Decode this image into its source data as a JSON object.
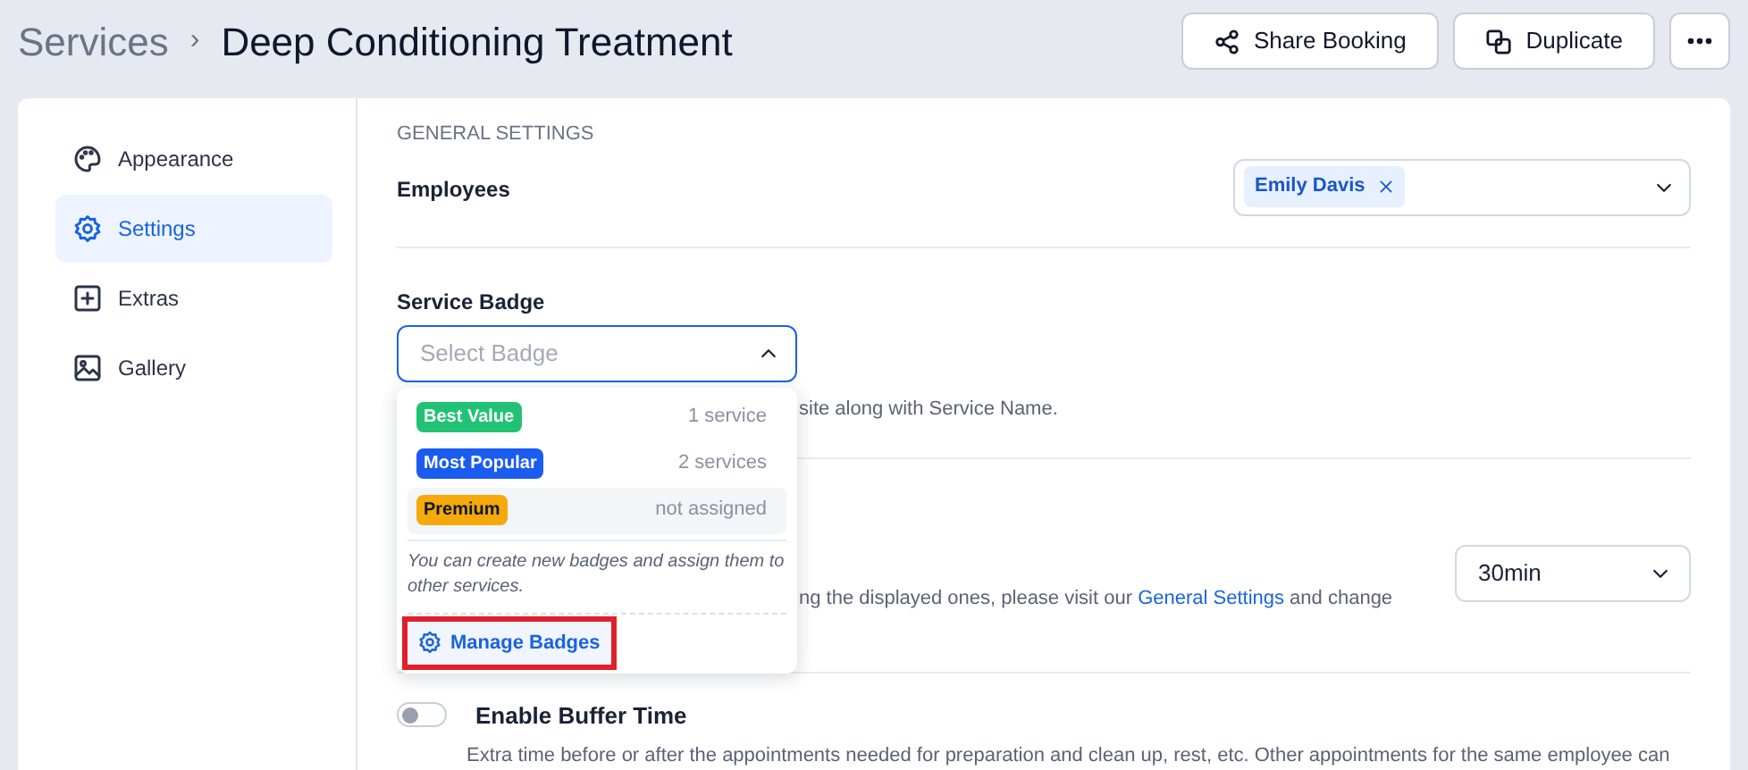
{
  "header": {
    "breadcrumb_parent": "Services",
    "separator": "›",
    "title": "Deep Conditioning Treatment",
    "buttons": [
      {
        "label": "Share Booking",
        "kind": "share"
      },
      {
        "label": "Duplicate",
        "kind": "duplicate"
      },
      {
        "kind": "more"
      }
    ]
  },
  "sidebar": {
    "items": [
      {
        "label": "Appearance",
        "kind": "palette",
        "selected": false
      },
      {
        "label": "Settings",
        "kind": "gear",
        "selected": true
      },
      {
        "label": "Extras",
        "kind": "plus",
        "selected": false
      },
      {
        "label": "Gallery",
        "kind": "image",
        "selected": false
      }
    ]
  },
  "content": {
    "section_title": "GENERAL SETTINGS",
    "employees": {
      "label": "Employees",
      "chips": [
        "Emily Davis"
      ]
    },
    "service_badge": {
      "label": "Service Badge",
      "placeholder": "Select Badge",
      "expanded": true,
      "help_text": "site along with Service Name.",
      "dropdown": {
        "options": [
          {
            "badge": "Best Value",
            "color": "#22c274",
            "count": "1 service",
            "hovered": false
          },
          {
            "badge": "Most Popular",
            "color": "#1a5cf0",
            "count": "2 services",
            "hovered": false
          },
          {
            "badge": "Premium",
            "color": "#f5a90a",
            "count": "not assigned",
            "hovered": true
          }
        ],
        "note": "You can create new badges and assign them to other services.",
        "manage_link": {
          "label": "Manage Badges",
          "highlighted": true
        }
      }
    },
    "duration": {
      "value": "30min",
      "help_before": "ng the displayed ones, please visit our",
      "help_link": "General Settings",
      "help_after": "and change"
    },
    "buffer": {
      "label": "Enable Buffer Time",
      "on": false,
      "description": "Extra time before or after the appointments needed for preparation and clean up, rest, etc. Other appointments for the same employee can"
    }
  }
}
